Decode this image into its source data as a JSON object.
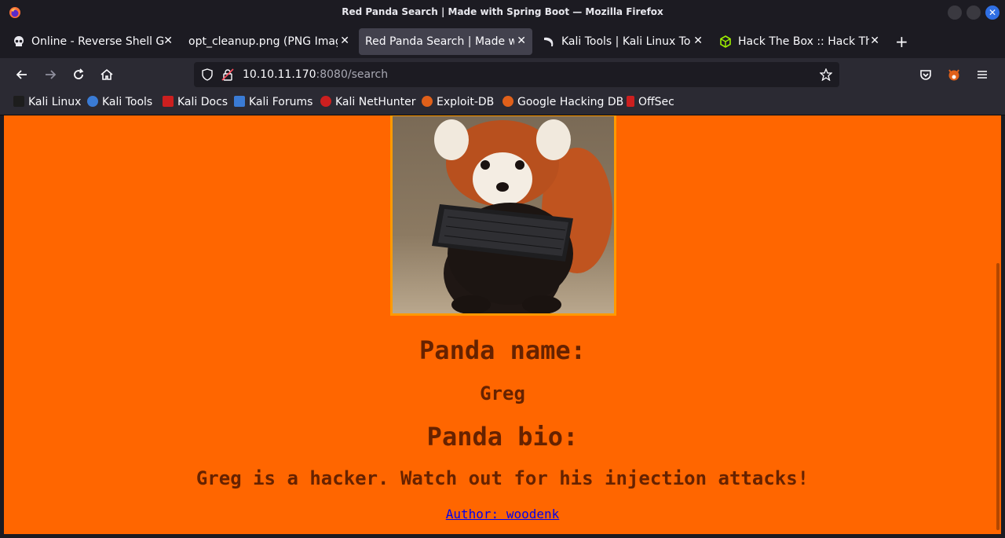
{
  "window": {
    "title": "Red Panda Search | Made with Spring Boot — Mozilla Firefox"
  },
  "tabs": [
    {
      "label": "Online - Reverse Shell Gen",
      "icon": "skull-icon",
      "active": false
    },
    {
      "label": "opt_cleanup.png (PNG Image",
      "icon": "none",
      "active": false
    },
    {
      "label": "Red Panda Search | Made wit",
      "icon": "none",
      "active": true
    },
    {
      "label": "Kali Tools | Kali Linux Tool",
      "icon": "kali-dragon-icon",
      "active": false
    },
    {
      "label": "Hack The Box :: Hack The B",
      "icon": "htb-cube-icon",
      "active": false
    }
  ],
  "urlbar": {
    "host": "10.10.11.170",
    "rest": ":8080/search"
  },
  "bookmarks": [
    {
      "label": "Kali Linux",
      "color": "#1d1d1d"
    },
    {
      "label": "Kali Tools",
      "color": "#3a7bd5"
    },
    {
      "label": "Kali Docs",
      "color": "#cc1f1f"
    },
    {
      "label": "Kali Forums",
      "color": "#3a7bd5"
    },
    {
      "label": "Kali NetHunter",
      "color": "#cc1f1f"
    },
    {
      "label": "Exploit-DB",
      "color": "#e0601a"
    },
    {
      "label": "Google Hacking DB",
      "color": "#e0601a"
    },
    {
      "label": "OffSec",
      "color": "#cc1f1f"
    }
  ],
  "page": {
    "name_heading": "Panda name:",
    "name_value": "Greg",
    "bio_heading": "Panda bio:",
    "bio_value": "Greg is a hacker. Watch out for his injection attacks!",
    "author_link": "Author: woodenk"
  },
  "colors": {
    "page_bg": "#ff6600",
    "text": "#662200",
    "link": "#0000ee",
    "image_border": "#ff9900"
  }
}
